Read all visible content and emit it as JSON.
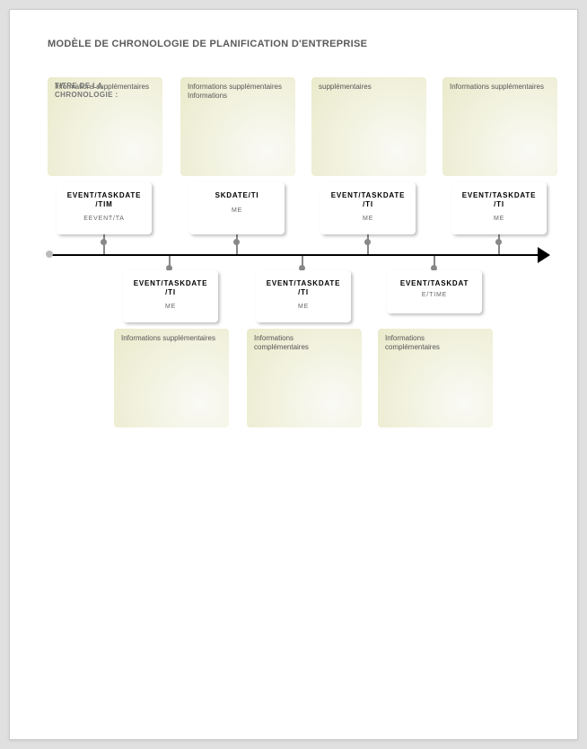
{
  "title": "MODÈLE DE CHRONOLOGIE DE PLANIFICATION D'ENTREPRISE",
  "subtitle": "TITRE DE LA\nCHRONOLOGIE :",
  "top_events": [
    {
      "info": "Informations supplémentaires",
      "line1": "EVENT/TASKDATE",
      "line2": "/TIM",
      "sub": "EEVENT/TA"
    },
    {
      "info": "Informations supplémentaires\nInformations",
      "line1": "SKDATE/TI",
      "line2": "",
      "sub": "ME"
    },
    {
      "info": "supplémentaires",
      "line1": "EVENT/TASKDATE",
      "line2": "/TI",
      "sub": "ME"
    },
    {
      "info": "Informations supplémentaires",
      "line1": "EVENT/TASKDATE",
      "line2": "/TI",
      "sub": "ME"
    }
  ],
  "bottom_events": [
    {
      "info": "Informations supplémentaires",
      "line1": "EVENT/TASKDATE",
      "line2": "/TI",
      "sub": "ME"
    },
    {
      "info": "Informations\ncomplémentaires",
      "line1": "EVENT/TASKDATE",
      "line2": "/TI",
      "sub": "ME"
    },
    {
      "info": "Informations\ncomplémentaires",
      "line1": "EVENT/TASKDAT",
      "line2": "",
      "sub": "E/TIME"
    }
  ]
}
